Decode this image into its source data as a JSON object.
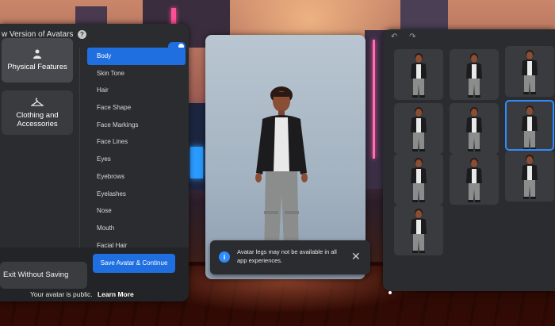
{
  "header": {
    "title": "w Version of Avatars",
    "help_icon": "help-icon",
    "toggle_on": true
  },
  "categories": [
    {
      "label": "Physical Features",
      "icon": "person-icon",
      "active": true
    },
    {
      "label": "Clothing and Accessories",
      "icon": "hanger-icon",
      "active": false
    }
  ],
  "features": {
    "items": [
      "Body",
      "Skin Tone",
      "Hair",
      "Face Shape",
      "Face Markings",
      "Face Lines",
      "Eyes",
      "Eyebrows",
      "Eyelashes",
      "Nose",
      "Mouth",
      "Facial Hair"
    ],
    "selected": "Body"
  },
  "footer": {
    "exit_label": "Exit Without Saving",
    "save_label": "Save Avatar & Continue",
    "public_text": "Your avatar is public.",
    "learn_more": "Learn More"
  },
  "notice": {
    "icon": "info-icon",
    "message": "Avatar legs may not be available in all app experiences.",
    "close": "✕"
  },
  "right_panel": {
    "undo_redo": "↶ ↷",
    "tile_count": 10,
    "selected_tile": 5
  },
  "colors": {
    "accent": "#1f6fe0",
    "panel": "#2b2c2f"
  }
}
